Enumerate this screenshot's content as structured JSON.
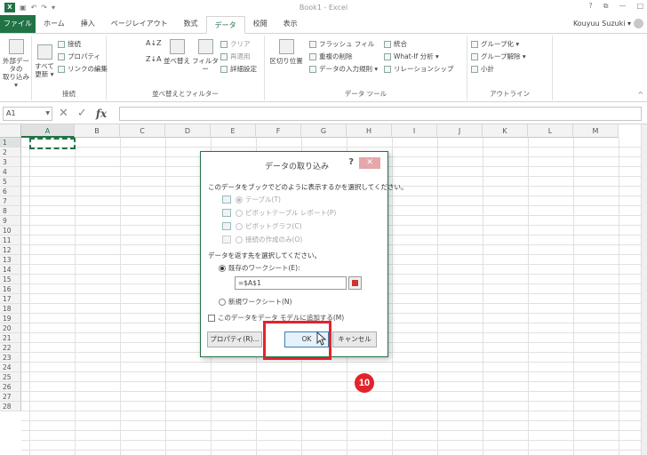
{
  "app": {
    "title": "Book1 - Excel",
    "quick_access": [
      "↶",
      "↷",
      "▾"
    ],
    "window_controls": [
      "?",
      "⧉",
      "—",
      "□"
    ]
  },
  "tabs": [
    {
      "label": "ファイル",
      "kind": "file"
    },
    {
      "label": "ホーム"
    },
    {
      "label": "挿入"
    },
    {
      "label": "ページレイアウト"
    },
    {
      "label": "数式"
    },
    {
      "label": "データ",
      "active": true
    },
    {
      "label": "校閲"
    },
    {
      "label": "表示"
    }
  ],
  "user": {
    "name": "Kouyuu Suzuki ▾"
  },
  "ribbon": {
    "get_external": {
      "label_line1": "外部データの",
      "label_line2": "取り込み ▾"
    },
    "connections": {
      "refresh_all_1": "すべて",
      "refresh_all_2": "更新 ▾",
      "connections": "接続",
      "properties": "プロパティ",
      "edit_links": "リンクの編集",
      "group_label": "接続"
    },
    "sort_filter": {
      "sort_asc": "A↓Z",
      "sort_desc": "Z↓A",
      "sort": "並べ替え",
      "filter": "フィルター",
      "clear": "クリア",
      "reapply": "再適用",
      "advanced": "詳細設定",
      "group_label": "並べ替えとフィルター"
    },
    "data_tools": {
      "text_to_columns": "区切り位置",
      "flash_fill": "フラッシュ フィル",
      "remove_duplicates": "重複の削除",
      "data_validation": "データの入力規則 ▾",
      "consolidate": "統合",
      "what_if": "What-If 分析 ▾",
      "relationships": "リレーションシップ",
      "group_label": "データ ツール"
    },
    "outline": {
      "group": "グループ化 ▾",
      "ungroup": "グループ解除 ▾",
      "subtotal": "小計",
      "group_label": "アウトライン"
    },
    "collapse": "^"
  },
  "formula_bar": {
    "name_box": "A1",
    "cancel": "✕",
    "enter": "✓",
    "fx": "fx",
    "value": ""
  },
  "sheet": {
    "columns": [
      "A",
      "B",
      "C",
      "D",
      "E",
      "F",
      "G",
      "H",
      "I",
      "J",
      "K",
      "L",
      "M"
    ],
    "rows": [
      "1",
      "2",
      "3",
      "4",
      "5",
      "6",
      "7",
      "8",
      "9",
      "10",
      "11",
      "12",
      "13",
      "14",
      "15",
      "16",
      "17",
      "18",
      "19",
      "20",
      "21",
      "22",
      "23",
      "24",
      "25",
      "26",
      "27",
      "28"
    ]
  },
  "dialog": {
    "title": "データの取り込み",
    "help": "?",
    "close": "✕",
    "prompt_view": "このデータをブックでどのように表示するかを選択してください。",
    "options_view": [
      {
        "label": "テーブル(T)",
        "selected": true
      },
      {
        "label": "ピボットテーブル レポート(P)",
        "selected": false
      },
      {
        "label": "ピボットグラフ(C)",
        "selected": false
      },
      {
        "label": "接続の作成のみ(O)",
        "selected": false
      }
    ],
    "prompt_dest": "データを返す先を選択してください。",
    "existing_sheet": "既存のワークシート(E):",
    "cell_ref": "=$A$1",
    "new_sheet": "新規ワークシート(N)",
    "data_model": "このデータをデータ モデルに追加する(M)",
    "properties_button": "プロパティ(R)...",
    "ok_button": "OK",
    "cancel_button": "キャンセル"
  },
  "annotation": {
    "step": "10",
    "color": "#e3232b"
  },
  "colors": {
    "excel_green": "#217346",
    "highlight_red": "#e3232b"
  }
}
